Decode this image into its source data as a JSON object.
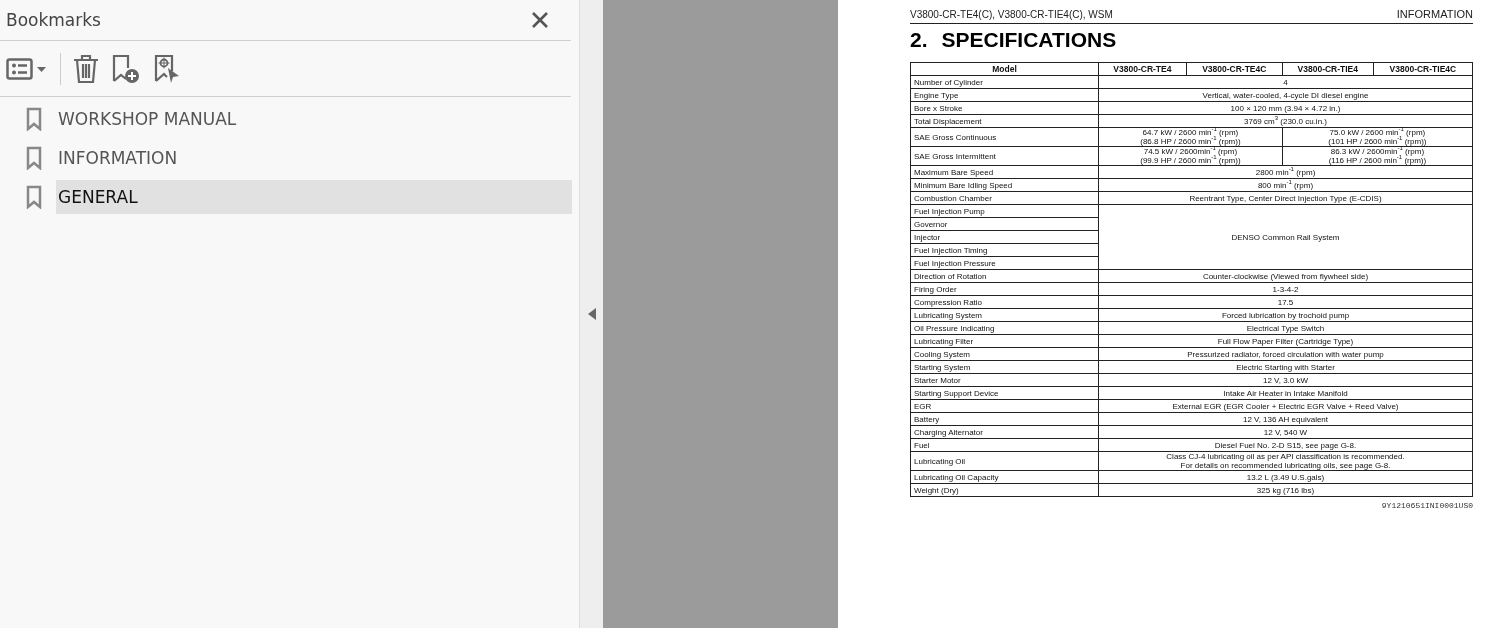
{
  "panel": {
    "title": "Bookmarks",
    "bookmarks": [
      {
        "label": "WORKSHOP MANUAL",
        "selected": false
      },
      {
        "label": "INFORMATION",
        "selected": false
      },
      {
        "label": "GENERAL",
        "selected": true
      }
    ]
  },
  "page": {
    "header_left": "V3800-CR-TE4(C), V3800-CR-TIE4(C), WSM",
    "header_right": "INFORMATION",
    "heading_number": "2.",
    "heading": "SPECIFICATIONS",
    "table": {
      "columns": [
        "Model",
        "V3800-CR-TE4",
        "V3800-CR-TE4C",
        "V3800-CR-TIE4",
        "V3800-CR-TIE4C"
      ],
      "rows": [
        {
          "kind": "single",
          "label": "Number of Cylinder",
          "value": "4"
        },
        {
          "kind": "single",
          "label": "Engine Type",
          "value": "Vertical, water-cooled, 4-cycle DI diesel engine"
        },
        {
          "kind": "single",
          "label": "Bore x Stroke",
          "value": "100 × 120 mm (3.94 × 4.72 in.)"
        },
        {
          "kind": "single",
          "label": "Total Displacement",
          "value": "3769 cm$^{3}$ (230.0 cu.in.)"
        },
        {
          "kind": "split",
          "label": "SAE Gross Continuous",
          "values": [
            [
              "64.7 kW / 2600 min$^{-1}$ (rpm)",
              "(86.8 HP / 2600 min$^{-1}$ (rpm))"
            ],
            [
              "75.0 kW / 2600 min$^{-1}$ (rpm)",
              "(101 HP / 2600 min$^{-1}$ (rpm))"
            ]
          ]
        },
        {
          "kind": "split",
          "label": "SAE Gross Intermittent",
          "values": [
            [
              "74.5 kW / 2600min$^{-1}$ (rpm)",
              "(99.9 HP / 2600 min$^{-1}$ (rpm))"
            ],
            [
              "86.3 kW / 2600min$^{-1}$ (rpm)",
              "(116 HP / 2600 min$^{-1}$ (rpm))"
            ]
          ]
        },
        {
          "kind": "single",
          "label": "Maximum Bare Speed",
          "value": "2800 min$^{-1}$ (rpm)"
        },
        {
          "kind": "single",
          "label": "Minimum Bare Idling Speed",
          "value": "800 min$^{-1}$ (rpm)"
        },
        {
          "kind": "single",
          "label": "Combustion Chamber",
          "value": "Reentrant Type, Center Direct Injection Type (E-CDIS)"
        },
        {
          "kind": "group",
          "labels": [
            "Fuel Injection Pump",
            "Governor",
            "Injector",
            "Fuel Injection Timing",
            "Fuel Injection Pressure"
          ],
          "value": "DENSO Common Rail System"
        },
        {
          "kind": "single",
          "label": "Direction of Rotation",
          "value": "Counter-clockwise (Viewed from flywheel side)"
        },
        {
          "kind": "single",
          "label": "Firing Order",
          "value": "1-3-4-2"
        },
        {
          "kind": "single",
          "label": "Compression Ratio",
          "value": "17.5"
        },
        {
          "kind": "single",
          "label": "Lubricating System",
          "value": "Forced lubrication by trochoid pump"
        },
        {
          "kind": "single",
          "label": "Oil Pressure Indicating",
          "value": "Electrical Type Switch"
        },
        {
          "kind": "single",
          "label": "Lubricating Filter",
          "value": "Full Flow Paper Filter (Cartridge Type)"
        },
        {
          "kind": "single",
          "label": "Cooling System",
          "value": "Pressurized radiator, forced circulation with water pump"
        },
        {
          "kind": "single",
          "label": "Starting System",
          "value": "Electric Starting with Starter"
        },
        {
          "kind": "single",
          "label": "Starter Motor",
          "value": "12 V, 3.0 kW"
        },
        {
          "kind": "single",
          "label": "Starting Support Device",
          "value": "Intake Air Heater in Intake Manifold"
        },
        {
          "kind": "single",
          "label": "EGR",
          "value": "External EGR (EGR Cooler + Electric EGR Valve + Reed Valve)"
        },
        {
          "kind": "single",
          "label": "Battery",
          "value": "12 V, 136 AH equivalent"
        },
        {
          "kind": "single",
          "label": "Charging Alternator",
          "value": "12 V, 540 W"
        },
        {
          "kind": "single",
          "label": "Fuel",
          "value": "Diesel Fuel No. 2-D S15, see page G-8."
        },
        {
          "kind": "lines",
          "label": "Lubricating Oil",
          "lines": [
            "Class CJ-4 lubricating oil as per API classification is recommended.",
            "For details on recommended lubricating oils, see page G-8."
          ]
        },
        {
          "kind": "single",
          "label": "Lubricating Oil Capacity",
          "value": "13.2 L (3.49 U.S.gals)"
        },
        {
          "kind": "single",
          "label": "Weight (Dry)",
          "value": "325 kg (716 lbs)"
        }
      ]
    },
    "code": "9Y1210651INI0001US0"
  }
}
